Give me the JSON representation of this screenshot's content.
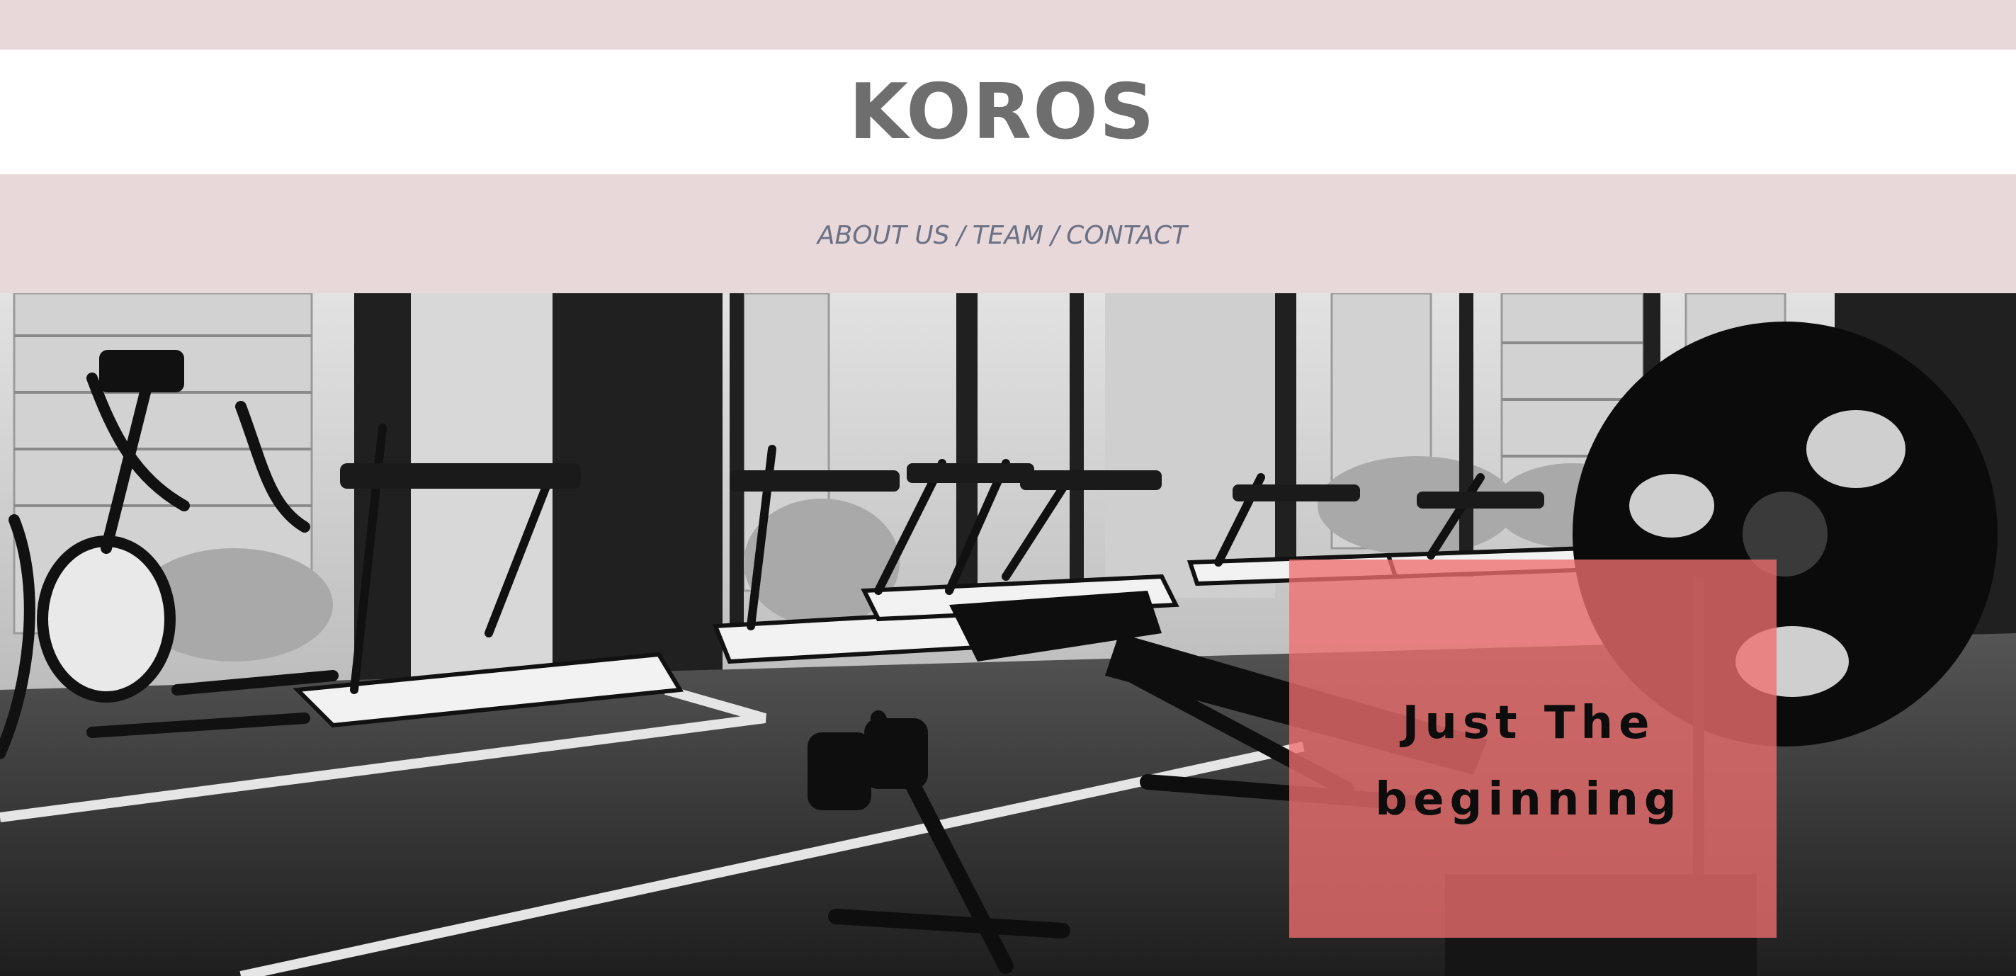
{
  "header": {
    "title": "KOROS"
  },
  "nav": {
    "items": [
      {
        "label": "ABOUT US"
      },
      {
        "label": "TEAM"
      },
      {
        "label": "CONTACT"
      }
    ],
    "separator": " / "
  },
  "hero": {
    "cta_text": "Just The\nbeginning"
  },
  "colors": {
    "header_band": "#e9d8da",
    "brand_text": "#6e6e6e",
    "nav_text": "#6b7185",
    "cta_box": "#f06e70",
    "cta_text": "#0d0d0d"
  }
}
